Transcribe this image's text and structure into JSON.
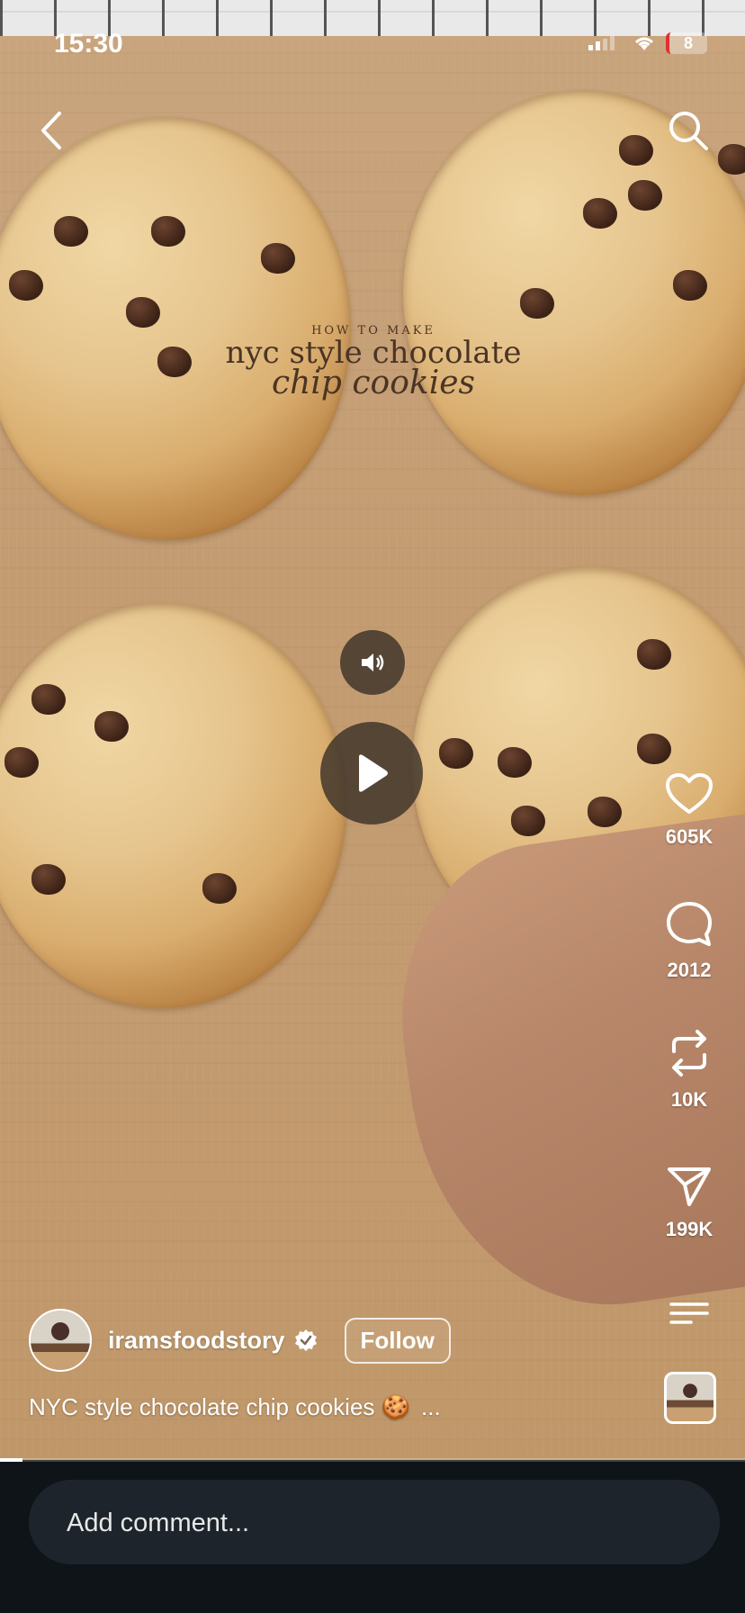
{
  "status_bar": {
    "time": "15:30",
    "battery": "8"
  },
  "video": {
    "overlay": {
      "small": "HOW TO MAKE",
      "line1": "nyc style chocolate",
      "line2": "chip cookies"
    },
    "progress": 0.03
  },
  "icons": {
    "back": "chevron-left-icon",
    "search": "search-icon",
    "sound": "speaker-icon",
    "play": "play-icon",
    "like": "heart-icon",
    "comment": "comment-bubble-icon",
    "repost": "repost-icon",
    "share": "send-icon",
    "more": "menu-icon"
  },
  "actions": {
    "likes": "605K",
    "comments": "2012",
    "reposts": "10K",
    "shares": "199K"
  },
  "author": {
    "username": "iramsfoodstory",
    "follow_label": "Follow"
  },
  "caption": {
    "text": "NYC style chocolate chip cookies 🍪",
    "more": "..."
  },
  "comment_input": {
    "placeholder": "Add comment..."
  }
}
